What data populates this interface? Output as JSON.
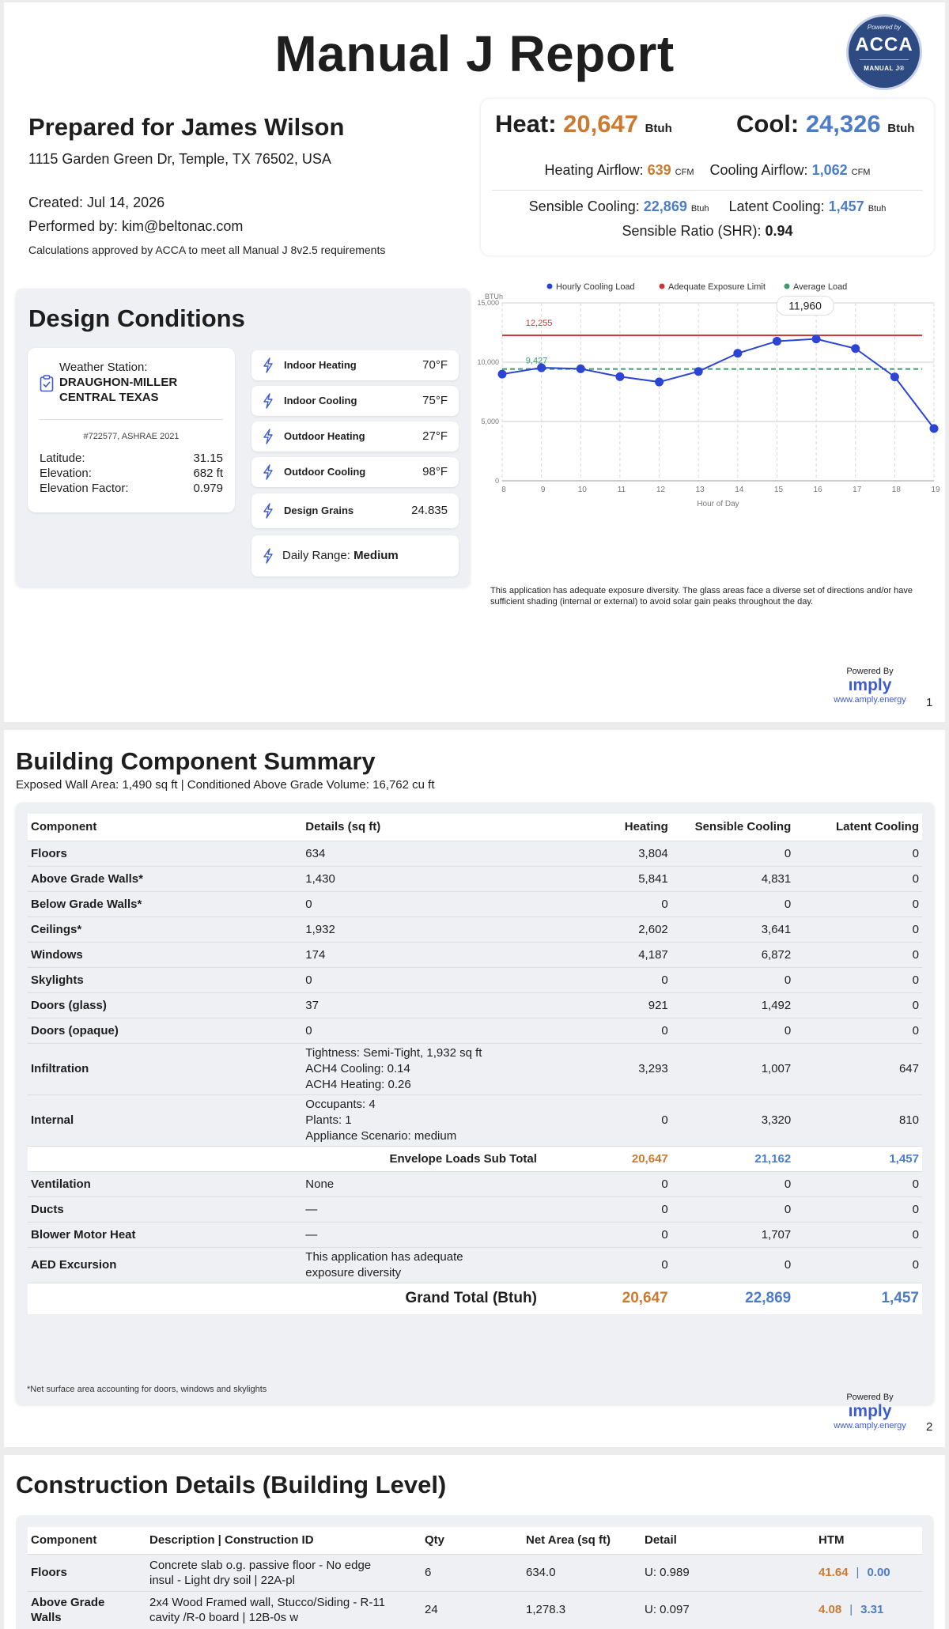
{
  "report": {
    "title": "Manual J Report",
    "badge": {
      "top": "Powered by",
      "brand": "ACCA",
      "bottom": "MANUAL J®"
    },
    "prepared_for": "Prepared for James Wilson",
    "address": "1115 Garden Green Dr, Temple, TX 76502, USA",
    "created": "Created: Jul 14, 2026",
    "performed_by": "Performed by: kim@beltonac.com",
    "approval": "Calculations approved by ACCA to meet all Manual J 8v2.5 requirements"
  },
  "loads": {
    "heat_label": "Heat:",
    "heat_value": "20,647",
    "heat_unit": "Btuh",
    "cool_label": "Cool:",
    "cool_value": "24,326",
    "cool_unit": "Btuh",
    "heating_airflow_label": "Heating Airflow:",
    "heating_airflow_value": "639",
    "cfm_unit": "CFM",
    "cooling_airflow_label": "Cooling Airflow:",
    "cooling_airflow_value": "1,062",
    "sensible_label": "Sensible Cooling:",
    "sensible_value": "22,869",
    "btuh_small": "Btuh",
    "latent_label": "Latent Cooling:",
    "latent_value": "1,457",
    "shr_label": "Sensible Ratio (SHR):",
    "shr_value": "0.94",
    "colors": {
      "heat": "#cc7a30",
      "cool": "#4d7cc7"
    }
  },
  "design_conditions": {
    "title": "Design Conditions",
    "weather_station_label": "Weather Station:",
    "weather_station_name": "DRAUGHON-MILLER CENTRAL TEXAS",
    "station_id": "#722577, ASHRAE 2021",
    "latitude_label": "Latitude:",
    "latitude_value": "31.15",
    "elevation_label": "Elevation:",
    "elevation_value": "682 ft",
    "elev_factor_label": "Elevation Factor:",
    "elev_factor_value": "0.979",
    "items": [
      {
        "label": "Indoor Heating",
        "value": "70°F"
      },
      {
        "label": "Indoor Cooling",
        "value": "75°F"
      },
      {
        "label": "Outdoor Heating",
        "value": "27°F"
      },
      {
        "label": "Outdoor Cooling",
        "value": "98°F"
      },
      {
        "label": "Design Grains",
        "value": "24.835"
      }
    ],
    "daily_range_label": "Daily Range:",
    "daily_range_value": "Medium",
    "icon": "lightning-bolt-icon"
  },
  "chart_data": {
    "type": "line",
    "ylabel": "BTUh",
    "xlabel": "Hour of Day",
    "x": [
      8,
      9,
      10,
      11,
      12,
      13,
      14,
      15,
      16,
      17,
      18,
      19
    ],
    "xlim": [
      8,
      19
    ],
    "ylim": [
      0,
      15000
    ],
    "yticks": [
      "0",
      "5,000",
      "10,000",
      "15,000"
    ],
    "ytick_values": [
      0,
      5000,
      10000,
      15000
    ],
    "grid": true,
    "legend_position": "top-center",
    "series": [
      {
        "name": "Hourly Cooling Load",
        "color": "#2b44d6",
        "values": [
          8990,
          9530,
          9440,
          8780,
          8330,
          9220,
          10750,
          11770,
          11960,
          11150,
          8760,
          4410
        ]
      },
      {
        "name": "Adequate Exposure Limit",
        "color": "#c43a3a",
        "values": [
          12255,
          12255,
          12255,
          12255,
          12255,
          12255,
          12255,
          12255,
          12255,
          12255,
          12255,
          12255
        ]
      },
      {
        "name": "Average Load",
        "color": "#3c9a6c",
        "values": [
          9427,
          9427,
          9427,
          9427,
          9427,
          9427,
          9427,
          9427,
          9427,
          9427,
          9427,
          9427
        ]
      }
    ],
    "annotations": {
      "limit": "12,255",
      "average": "9,427",
      "peak": "11,960"
    }
  },
  "chart_note": "This application has adequate exposure diversity. The glass areas face a diverse set of directions and/or have sufficient shading (internal or external) to avoid solar gain peaks throughout the day.",
  "powered_by": {
    "label": "Powered By",
    "brand": "ımply",
    "url": "www.amply.energy"
  },
  "page_numbers": [
    "1",
    "2"
  ],
  "building_summary": {
    "title": "Building Component Summary",
    "subtitle": "Exposed Wall Area: 1,490 sq ft | Conditioned Above Grade Volume: 16,762 cu ft",
    "headers": [
      "Component",
      "Details (sq ft)",
      "Heating",
      "Sensible Cooling",
      "Latent Cooling"
    ],
    "rows": [
      [
        "Floors",
        "634",
        "3,804",
        "0",
        "0"
      ],
      [
        "Above Grade Walls*",
        "1,430",
        "5,841",
        "4,831",
        "0"
      ],
      [
        "Below Grade Walls*",
        "0",
        "0",
        "0",
        "0"
      ],
      [
        "Ceilings*",
        "1,932",
        "2,602",
        "3,641",
        "0"
      ],
      [
        "Windows",
        "174",
        "4,187",
        "6,872",
        "0"
      ],
      [
        "Skylights",
        "0",
        "0",
        "0",
        "0"
      ],
      [
        "Doors (glass)",
        "37",
        "921",
        "1,492",
        "0"
      ],
      [
        "Doors (opaque)",
        "0",
        "0",
        "0",
        "0"
      ]
    ],
    "infiltration": {
      "label": "Infiltration",
      "details": [
        "Tightness: Semi-Tight, 1,932 sq ft",
        "ACH4 Cooling: 0.14",
        "ACH4 Heating: 0.26"
      ],
      "values": [
        "3,293",
        "1,007",
        "647"
      ]
    },
    "internal": {
      "label": "Internal",
      "details": [
        "Occupants: 4",
        "Plants: 1",
        "Appliance Scenario: medium"
      ],
      "values": [
        "0",
        "3,320",
        "810"
      ]
    },
    "subtotal": {
      "label": "Envelope Loads Sub Total",
      "values": [
        "20,647",
        "21,162",
        "1,457"
      ]
    },
    "rows_after": [
      [
        "Ventilation",
        "None",
        "0",
        "0",
        "0"
      ],
      [
        "Ducts",
        "—",
        "0",
        "0",
        "0"
      ],
      [
        "Blower Motor Heat",
        "—",
        "0",
        "1,707",
        "0"
      ]
    ],
    "aed": {
      "label": "AED Excursion",
      "details": [
        "This application has adequate",
        "exposure diversity"
      ],
      "values": [
        "0",
        "0",
        "0"
      ]
    },
    "grand_total": {
      "label": "Grand Total (Btuh)",
      "values": [
        "20,647",
        "22,869",
        "1,457"
      ]
    },
    "footnote": "*Net surface area accounting for doors, windows and skylights"
  },
  "construction": {
    "title": "Construction Details (Building Level)",
    "headers": [
      "Component",
      "Description | Construction ID",
      "Qty",
      "Net Area (sq ft)",
      "Detail",
      "HTM"
    ],
    "rows": [
      {
        "component": "Floors",
        "desc_line1": "Concrete slab o.g. passive floor - No edge",
        "desc_line2": "insul - Light dry soil | 22A-pl",
        "qty": "6",
        "area": "634.0",
        "detail": "U: 0.989",
        "htm_heat": "41.64",
        "htm_cool": "0.00"
      },
      {
        "component_line1": "Above Grade",
        "component_line2": "Walls",
        "desc_line1": "2x4 Wood Framed wall, Stucco/Siding - R-11",
        "desc_line2": "cavity /R-0 board | 12B-0s w",
        "qty": "24",
        "area": "1,278.3",
        "detail": "U: 0.097",
        "htm_heat": "4.08",
        "htm_cool": "3.31"
      }
    ],
    "htm_separator": "|"
  }
}
